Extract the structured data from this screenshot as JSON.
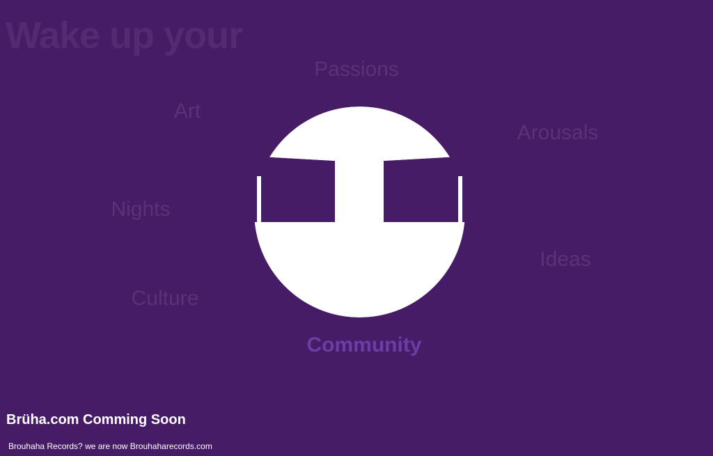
{
  "headline": "Wake up your",
  "words": {
    "passions": "Passions",
    "art": "Art",
    "arousals": "Arousals",
    "nights": "Nights",
    "ideas": "Ideas",
    "culture": "Culture",
    "community": "Community"
  },
  "active_word": "Community",
  "footer": {
    "title": "Brüha.com Comming Soon",
    "note_prefix": "Brouhaha Records? we are now",
    "note_link": "Brouhaharecords.com"
  },
  "colors": {
    "background": "#471c67",
    "logo": "#ffffff",
    "faded_word": "#5a3377",
    "active_word": "#6a3ea6"
  },
  "icons": {
    "logo": "bruha-circle-logo"
  }
}
